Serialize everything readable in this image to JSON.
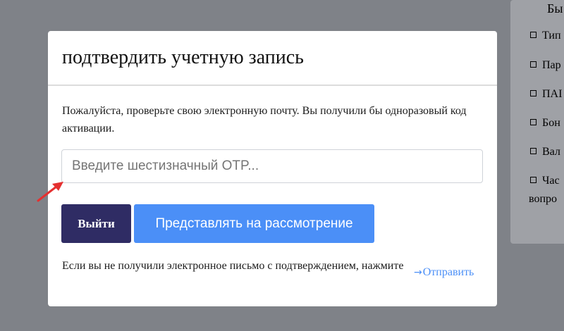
{
  "background": {
    "heading": "Бы",
    "items": [
      "Тип",
      "Пар",
      "ПАІ",
      "Бон",
      "Вал",
      "Час"
    ],
    "trailing_text": "вопро"
  },
  "modal": {
    "title": "подтвердить учетную запись",
    "message": "Пожалуйста, проверьте свою электронную почту. Вы получили бы одноразовый код активации.",
    "otp_placeholder": "Введите шестизначный OTP...",
    "otp_value": "",
    "exit_label": "Выйти",
    "submit_label": "Представлять на рассмотрение",
    "resend_text": "Если вы не получили электронное письмо с подтверждением, нажмите",
    "resend_link": "Отправить"
  },
  "colors": {
    "overlay": "#7f8288",
    "exit_button": "#2f2c64",
    "submit_button": "#4b8ff7",
    "link": "#4b8ff7",
    "annotation_arrow": "#e53030"
  },
  "icons": {
    "resend": "arrow-right-icon",
    "annotation": "red-pointer-arrow-icon"
  }
}
